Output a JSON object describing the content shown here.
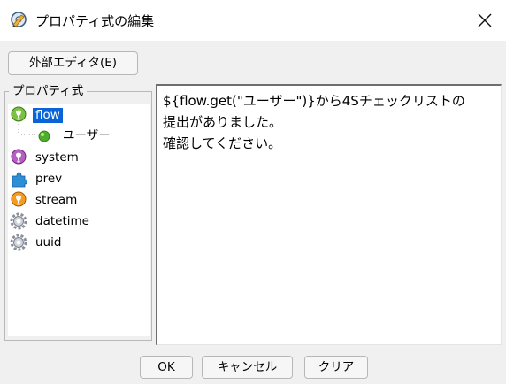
{
  "window": {
    "title": "プロパティ式の編集",
    "icon": "pencil-gear-icon"
  },
  "toolbar": {
    "external_editor_label": "外部エディタ(E)"
  },
  "properties": {
    "group_label": "プロパティ式",
    "items": [
      {
        "label": "flow",
        "icon": "lightbulb-green-icon",
        "selected": true
      },
      {
        "label": "ユーザー",
        "icon": "green-ball-icon",
        "child": true
      },
      {
        "label": "system",
        "icon": "lightbulb-purple-icon"
      },
      {
        "label": "prev",
        "icon": "puzzle-blue-icon"
      },
      {
        "label": "stream",
        "icon": "lightbulb-orange-icon"
      },
      {
        "label": "datetime",
        "icon": "gear-icon"
      },
      {
        "label": "uuid",
        "icon": "gear-icon"
      }
    ]
  },
  "editor": {
    "lines": [
      "${flow.get(\"ユーザー\")}から4Sチェックリストの",
      "提出がありました。",
      "確認してください。"
    ]
  },
  "buttons": {
    "ok": "OK",
    "cancel": "キャンセル",
    "clear": "クリア"
  },
  "colors": {
    "selection": "#0a64d6",
    "window_bg": "#f0f0f0",
    "titlebar_bg": "#ffffff"
  }
}
